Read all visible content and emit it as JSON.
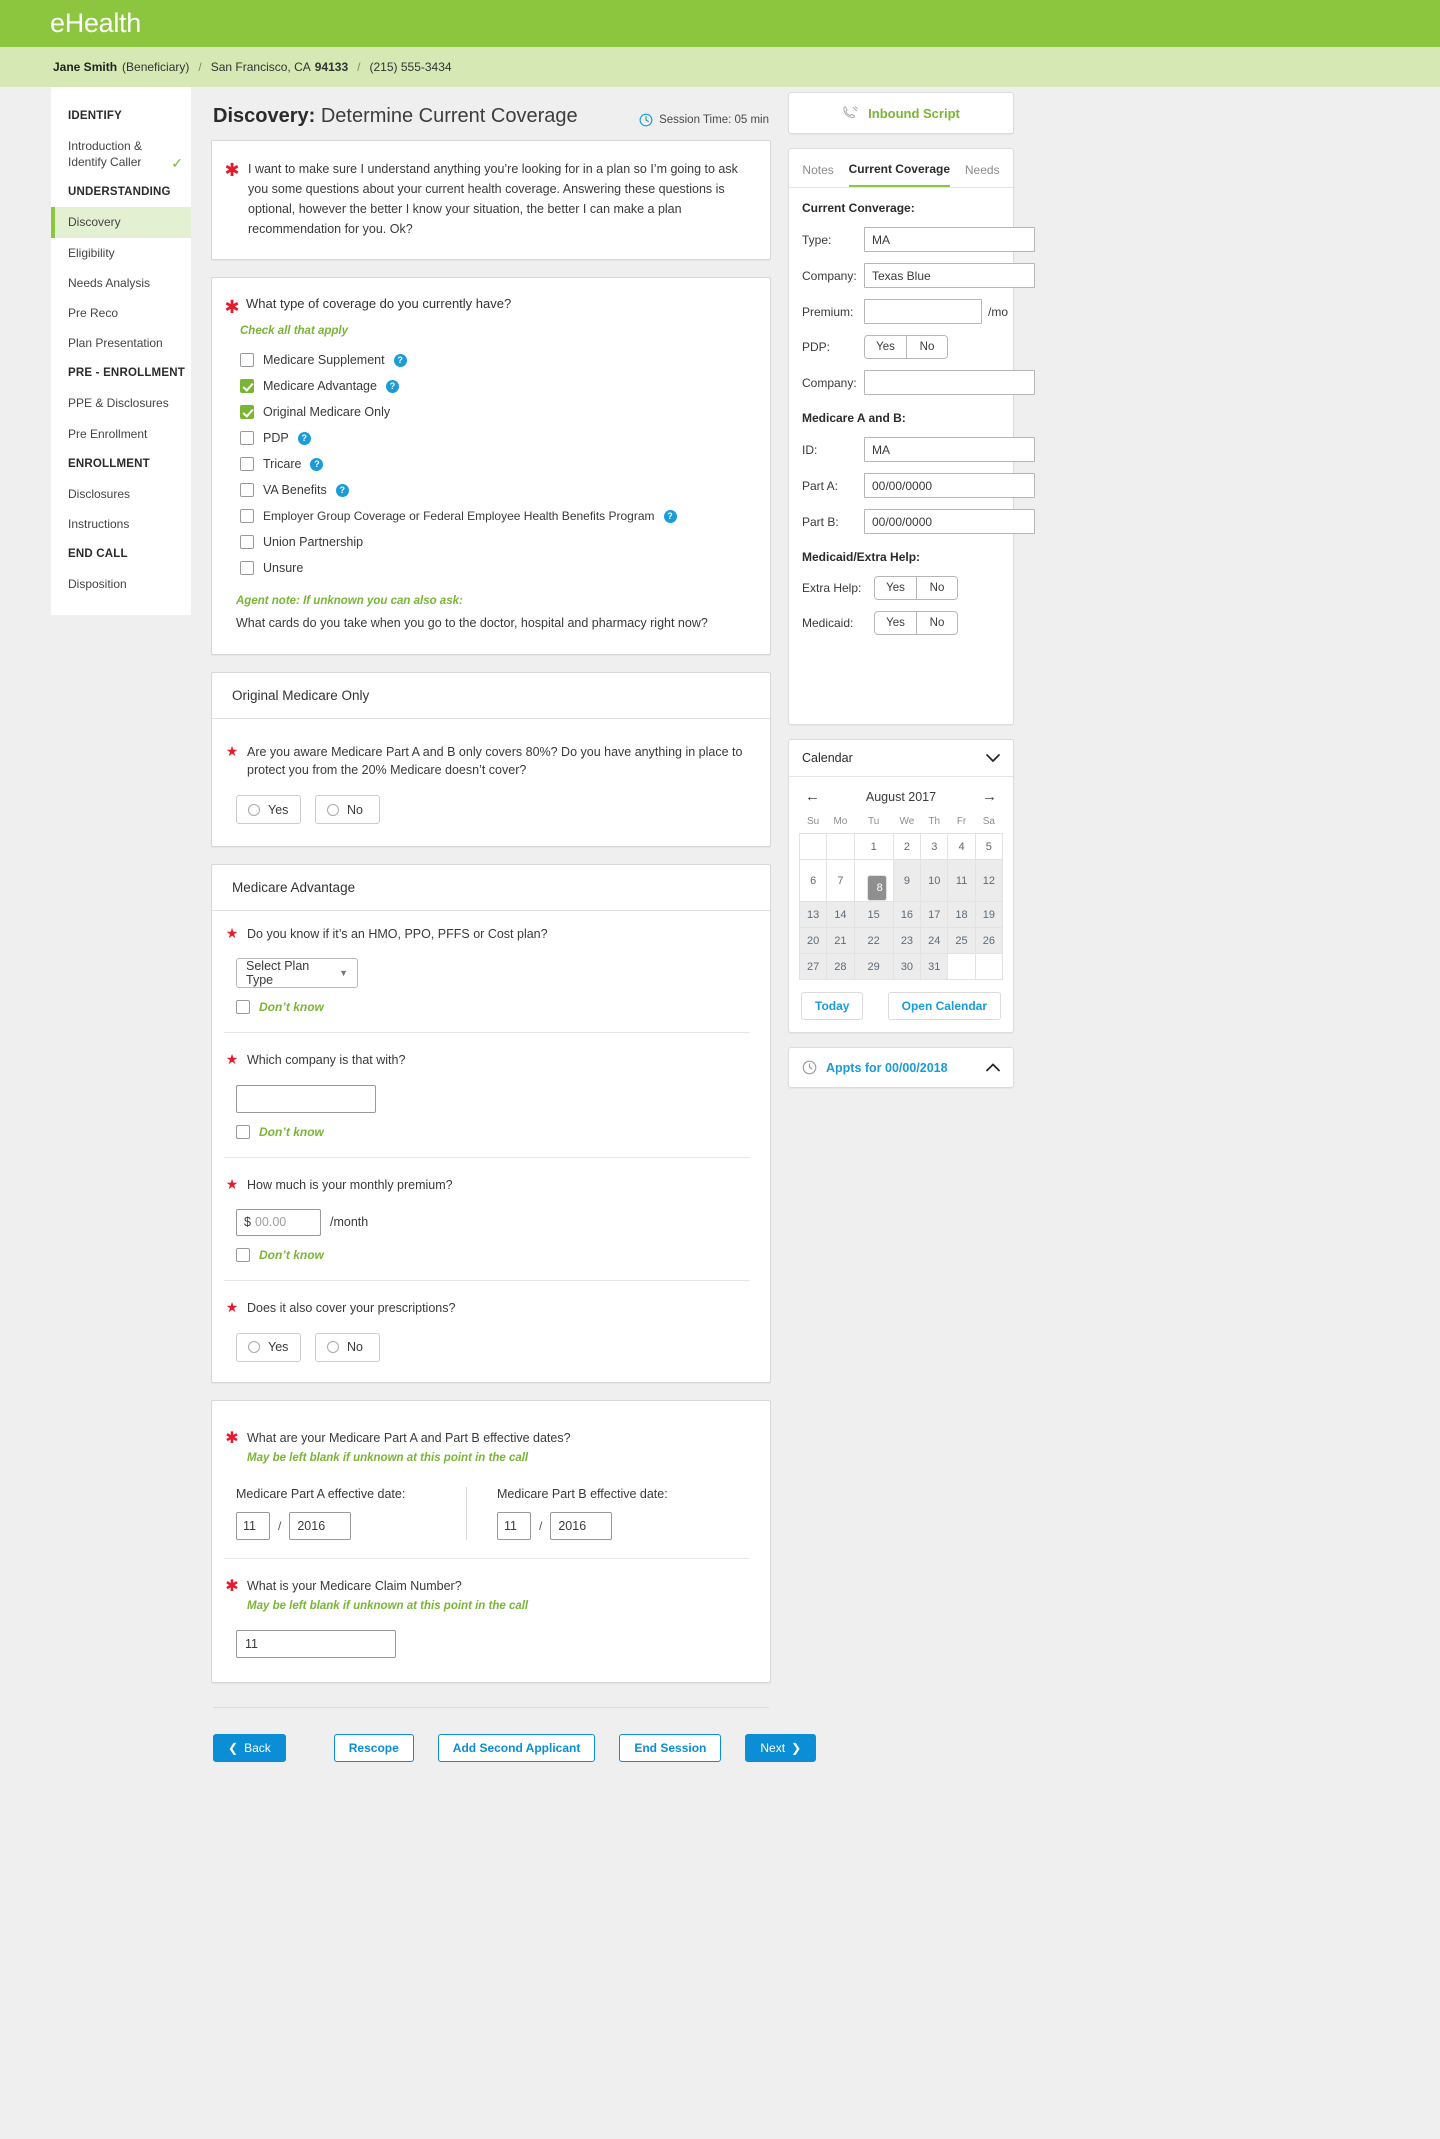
{
  "brand": {
    "logo": "eHealth",
    "green": "#8cc63e",
    "blue": "#0b8ed6",
    "red": "#e8192c"
  },
  "subbar": {
    "name": "Jane Smith",
    "role": "(Beneficiary)",
    "sep": "/",
    "city": "San Francisco, CA",
    "zip": "94133",
    "phone": "(215) 555-3434"
  },
  "sidebar": {
    "groups": [
      {
        "label": "IDENTIFY",
        "items": [
          {
            "label": "Introduction & Identify Caller",
            "active": false,
            "check": "✓"
          }
        ]
      },
      {
        "label": "UNDERSTANDING",
        "items": [
          {
            "label": "Discovery",
            "active": true
          },
          {
            "label": "Eligibility",
            "active": false
          },
          {
            "label": "Needs Analysis",
            "active": false
          },
          {
            "label": "Pre Reco",
            "active": false
          },
          {
            "label": "Plan Presentation",
            "active": false
          }
        ]
      },
      {
        "label": "PRE - ENROLLMENT",
        "items": [
          {
            "label": "PPE & Disclosures",
            "active": false
          },
          {
            "label": "Pre Enrollment",
            "active": false
          }
        ]
      },
      {
        "label": "ENROLLMENT",
        "items": [
          {
            "label": "Disclosures",
            "active": false
          },
          {
            "label": "Instructions",
            "active": false
          }
        ]
      },
      {
        "label": "END CALL",
        "items": [
          {
            "label": "Disposition",
            "active": false
          }
        ]
      }
    ]
  },
  "main": {
    "title_bold": "Discovery:",
    "title_rest": " Determine Current Coverage",
    "session_icon": "clock-icon",
    "session_label": "Session Time: 05 min",
    "script": "I want to make sure I understand anything you’re looking for in a plan so I’m going to ask you some questions about your current health coverage. Answering these questions is optional, however the better I know your situation, the better I can make a plan recommendation for you. Ok?",
    "coverage_q": {
      "question": "What type of coverage do you currently have?",
      "hint": "Check all that apply",
      "options": [
        {
          "label": "Medicare Supplement",
          "checked": false,
          "help": true
        },
        {
          "label": "Medicare Advantage",
          "checked": true,
          "help": true
        },
        {
          "label": "Original Medicare Only",
          "checked": true,
          "help": false
        },
        {
          "label": "PDP",
          "checked": false,
          "help": true
        },
        {
          "label": "Tricare",
          "checked": false,
          "help": true
        },
        {
          "label": "VA Benefits",
          "checked": false,
          "help": true
        },
        {
          "label": "Employer Group Coverage or Federal Employee Health Benefits Program",
          "checked": false,
          "help": true
        },
        {
          "label": "Union Partnership",
          "checked": false,
          "help": false
        },
        {
          "label": "Unsure",
          "checked": false,
          "help": false
        }
      ],
      "agent_note": "Agent note: If unknown you can also ask:",
      "agent_question": "What cards do you take when you go to the doctor, hospital and pharmacy right now?"
    },
    "original_medicare": {
      "heading": "Original Medicare Only",
      "question": "Are you aware Medicare Part A and B only covers 80%? Do you have anything in place to protect you from the 20% Medicare doesn’t cover?",
      "yes": "Yes",
      "no": "No"
    },
    "medicare_advantage": {
      "heading": "Medicare Advantage",
      "q1": "Do you know if it’s an HMO, PPO, PFFS or Cost plan?",
      "select_value": "Select Plan Type",
      "dont_know": "Don’t know",
      "q2": "Which company is that with?",
      "company_value": "",
      "q3": "How much is your monthly premium?",
      "currency": "$",
      "premium_placeholder": "00.00",
      "per_month": "/month",
      "q4": "Does it also cover your prescriptions?",
      "yes": "Yes",
      "no": "No"
    },
    "dates": {
      "question": "What are your Medicare Part A and Part B effective dates?",
      "hint": "May be left blank if unknown at this point in the call",
      "part_a_label": "Medicare Part A effective date:",
      "part_a_month": "11",
      "part_a_year": "2016",
      "part_b_label": "Medicare Part B effective date:",
      "part_b_month": "11",
      "part_b_year": "2016",
      "slash": "/"
    },
    "claim": {
      "question": "What is your Medicare Claim Number?",
      "hint": "May be left blank if unknown at this point in the call",
      "value": "11"
    },
    "buttons": {
      "back": "Back",
      "rescope": "Rescope",
      "add_second_applicant": "Add Second Applicant",
      "end_session": "End Session",
      "next": "Next"
    }
  },
  "right": {
    "inbound_script": "Inbound Script",
    "inbound_icon": "phone-script-icon",
    "tabs": [
      {
        "label": "Notes",
        "active": false
      },
      {
        "label": "Current Coverage",
        "active": true
      },
      {
        "label": "Needs",
        "active": false
      }
    ],
    "current_coverage": {
      "heading": "Current Converage:",
      "type_label": "Type:",
      "type_value": "MA",
      "company_label": "Company:",
      "company_value": "Texas Blue",
      "premium_label": "Premium:",
      "premium_value": "",
      "premium_unit": "/mo",
      "pdp_label": "PDP:",
      "pdp_yes": "Yes",
      "pdp_no": "No",
      "company2_label": "Company:",
      "company2_value": ""
    },
    "medicare_ab": {
      "heading": "Medicare A and B:",
      "id_label": "ID:",
      "id_value": "MA",
      "part_a_label": "Part A:",
      "part_a_value": "00/00/0000",
      "part_b_label": "Part B:",
      "part_b_value": "00/00/0000"
    },
    "medicaid": {
      "heading": "Medicaid/Extra Help:",
      "extra_help_label": "Extra Help:",
      "extra_help_yes": "Yes",
      "extra_help_no": "No",
      "medicaid_label": "Medicaid:",
      "medicaid_yes": "Yes",
      "medicaid_no": "No"
    },
    "calendar": {
      "title": "Calendar",
      "collapse_icon": "chevron-down-icon",
      "prev_icon": "arrow-left-icon",
      "next_icon": "arrow-right-icon",
      "month": "August 2017",
      "weekdays": [
        "Su",
        "Mo",
        "Tu",
        "We",
        "Th",
        "Fr",
        "Sa"
      ],
      "weeks": [
        [
          {
            "d": "",
            "s": "blank"
          },
          {
            "d": "",
            "s": "blank"
          },
          {
            "d": "1",
            "s": ""
          },
          {
            "d": "2",
            "s": ""
          },
          {
            "d": "3",
            "s": ""
          },
          {
            "d": "4",
            "s": ""
          },
          {
            "d": "5",
            "s": ""
          }
        ],
        [
          {
            "d": "6",
            "s": ""
          },
          {
            "d": "7",
            "s": ""
          },
          {
            "d": "8",
            "s": "sel"
          },
          {
            "d": "9",
            "s": "dim"
          },
          {
            "d": "10",
            "s": "dim"
          },
          {
            "d": "11",
            "s": "dim"
          },
          {
            "d": "12",
            "s": "dim"
          }
        ],
        [
          {
            "d": "13",
            "s": "dim"
          },
          {
            "d": "14",
            "s": "dim"
          },
          {
            "d": "15",
            "s": "dim"
          },
          {
            "d": "16",
            "s": "dim"
          },
          {
            "d": "17",
            "s": "dim"
          },
          {
            "d": "18",
            "s": "dim"
          },
          {
            "d": "19",
            "s": "dim"
          }
        ],
        [
          {
            "d": "20",
            "s": "dim"
          },
          {
            "d": "21",
            "s": "dim"
          },
          {
            "d": "22",
            "s": "dim"
          },
          {
            "d": "23",
            "s": "dim"
          },
          {
            "d": "24",
            "s": "dim"
          },
          {
            "d": "25",
            "s": "dim"
          },
          {
            "d": "26",
            "s": "dim"
          }
        ],
        [
          {
            "d": "27",
            "s": "dim"
          },
          {
            "d": "28",
            "s": "dim"
          },
          {
            "d": "29",
            "s": "dim"
          },
          {
            "d": "30",
            "s": "dim"
          },
          {
            "d": "31",
            "s": "dim"
          },
          {
            "d": "",
            "s": "blank"
          },
          {
            "d": "",
            "s": "blank"
          }
        ]
      ],
      "today": "Today",
      "open_calendar": "Open Calendar"
    },
    "appts": {
      "icon": "clock-icon",
      "label": "Appts for 00/00/2018",
      "toggle_icon": "chevron-up-icon"
    }
  }
}
